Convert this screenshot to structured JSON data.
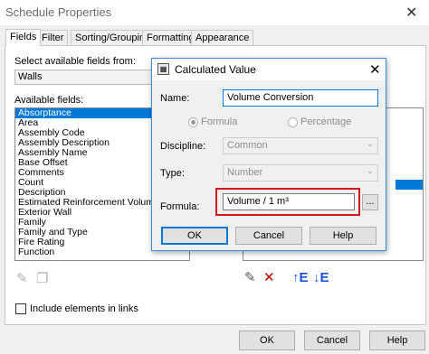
{
  "window": {
    "title": "Schedule Properties"
  },
  "tabs": [
    {
      "label": "Fields"
    },
    {
      "label": "Filter"
    },
    {
      "label": "Sorting/Grouping"
    },
    {
      "label": "Formatting"
    },
    {
      "label": "Appearance"
    }
  ],
  "fields_tab": {
    "select_label": "Select available fields from:",
    "select_value": "Walls",
    "available_label": "Available fields:",
    "available_fields": [
      "Absorptance",
      "Area",
      "Assembly Code",
      "Assembly Description",
      "Assembly Name",
      "Base Offset",
      "Comments",
      "Count",
      "Description",
      "Estimated Reinforcement Volume",
      "Exterior Wall",
      "Family",
      "Family and Type",
      "Fire Rating",
      "Function"
    ],
    "selected_field": "Absorptance",
    "include_links_label": "Include elements in links"
  },
  "footer": {
    "ok": "OK",
    "cancel": "Cancel",
    "help": "Help"
  },
  "dialog": {
    "title": "Calculated Value",
    "name_label": "Name:",
    "name_value": "Volume Conversion",
    "formula_radio": "Formula",
    "percentage_radio": "Percentage",
    "discipline_label": "Discipline:",
    "discipline_value": "Common",
    "type_label": "Type:",
    "type_value": "Number",
    "formula_label": "Formula:",
    "formula_value": "Volume / 1 m³",
    "browse_label": "...",
    "ok": "OK",
    "cancel": "Cancel",
    "help": "Help"
  },
  "colors": {
    "selection": "#0078d7",
    "highlight": "#d01818",
    "accent_blue": "#1a4fd6",
    "delete_red": "#c00000"
  }
}
